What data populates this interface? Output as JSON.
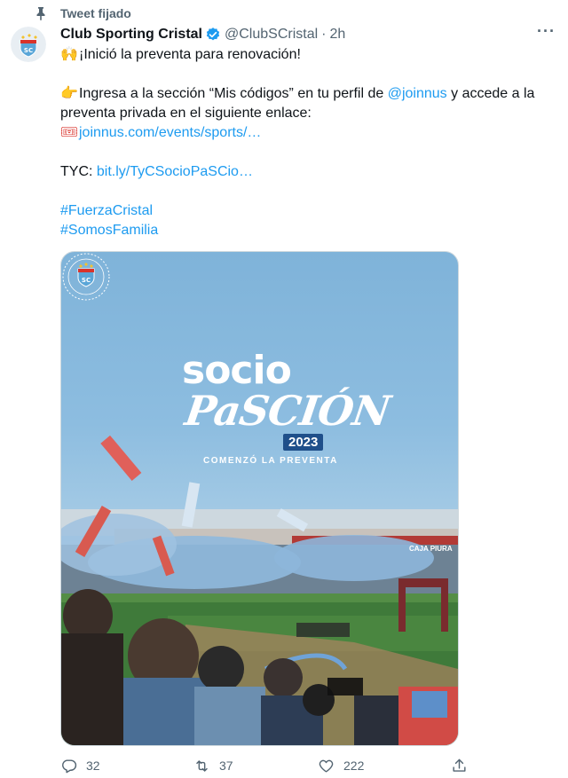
{
  "pinned_label": "Tweet fijado",
  "author": {
    "display_name": "Club Sporting Cristal",
    "handle": "@ClubSCristal",
    "time": "2h"
  },
  "tweet": {
    "line1": "¡Inició la preventa para renovación!",
    "line2_prefix": "Ingresa a la sección “Mis códigos” en tu perfil de ",
    "mention": "@joinnus",
    "line2_suffix": " y accede a la preventa privada en el siguiente enlace:",
    "link1": "joinnus.com/events/sports/…",
    "tyc_label": "TYC: ",
    "link2": "bit.ly/TyCSocioPaSCio…",
    "hashtag1": "#FuerzaCristal",
    "hashtag2": "#SomosFamilia"
  },
  "media": {
    "title_line1": "socio",
    "title_line2": "PaSCIÓN",
    "year": "2023",
    "subtitle": "COMENZÓ LA PREVENTA",
    "sponsor": "CAJA PIURA"
  },
  "actions": {
    "replies": "32",
    "retweets": "37",
    "likes": "222"
  },
  "colors": {
    "link": "#1d9bf0",
    "text": "#0f1419",
    "secondary": "#536471",
    "verified": "#1d9bf0"
  },
  "icons": [
    "pin-icon",
    "verified-icon",
    "more-icon",
    "raised-hands-emoji",
    "pointing-hand-emoji",
    "ticket-emoji",
    "reply-icon",
    "retweet-icon",
    "like-icon",
    "share-icon"
  ]
}
